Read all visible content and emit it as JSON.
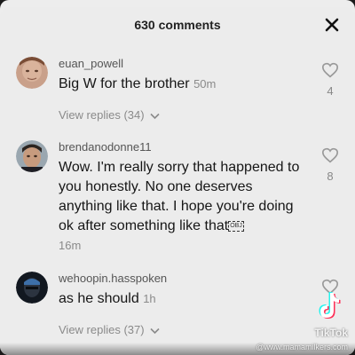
{
  "header": {
    "title": "630 comments"
  },
  "comments": [
    {
      "username": "euan_powell",
      "text": "Big W for the brother",
      "time": "50m",
      "likes": "4",
      "view_replies": "View replies (34)"
    },
    {
      "username": "brendanodonne11",
      "text": "Wow. I'm really sorry that happened to you honestly. No one deserves anything like that. I hope you're doing ok after something like that",
      "text_suffix_glyph": "OBJ",
      "time": "16m",
      "likes": "8"
    },
    {
      "username": "wehoopin.hasspoken",
      "text": "as he should",
      "time": "1h",
      "view_replies": "View replies (37)"
    }
  ],
  "watermark": {
    "label": "TikTok",
    "handle": "@www.mamamilkers.com"
  },
  "colors": {
    "sheet": "#ececec",
    "text": "#161616",
    "muted": "#8a8a8a"
  }
}
